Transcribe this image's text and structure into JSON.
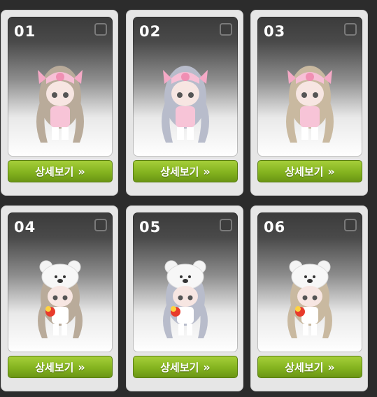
{
  "items": [
    {
      "number": "01",
      "button_label": "상세보기",
      "icon": "double-chevron-right-icon",
      "accessory": "pink-bow",
      "hair": "#b9ab9a"
    },
    {
      "number": "02",
      "button_label": "상세보기",
      "icon": "double-chevron-right-icon",
      "accessory": "pink-bow",
      "hair": "#b8bccb"
    },
    {
      "number": "03",
      "button_label": "상세보기",
      "icon": "double-chevron-right-icon",
      "accessory": "pink-bow",
      "hair": "#c9b9a0"
    },
    {
      "number": "04",
      "button_label": "상세보기",
      "icon": "double-chevron-right-icon",
      "accessory": "bear-hat",
      "hair": "#b9ab9a"
    },
    {
      "number": "05",
      "button_label": "상세보기",
      "icon": "double-chevron-right-icon",
      "accessory": "bear-hat",
      "hair": "#b8bccb"
    },
    {
      "number": "06",
      "button_label": "상세보기",
      "icon": "double-chevron-right-icon",
      "accessory": "bear-hat",
      "hair": "#c9b9a0"
    }
  ],
  "colors": {
    "button_green": "#84b31f",
    "card_bg": "#e6e6e6",
    "page_bg": "#2c2c2c"
  }
}
